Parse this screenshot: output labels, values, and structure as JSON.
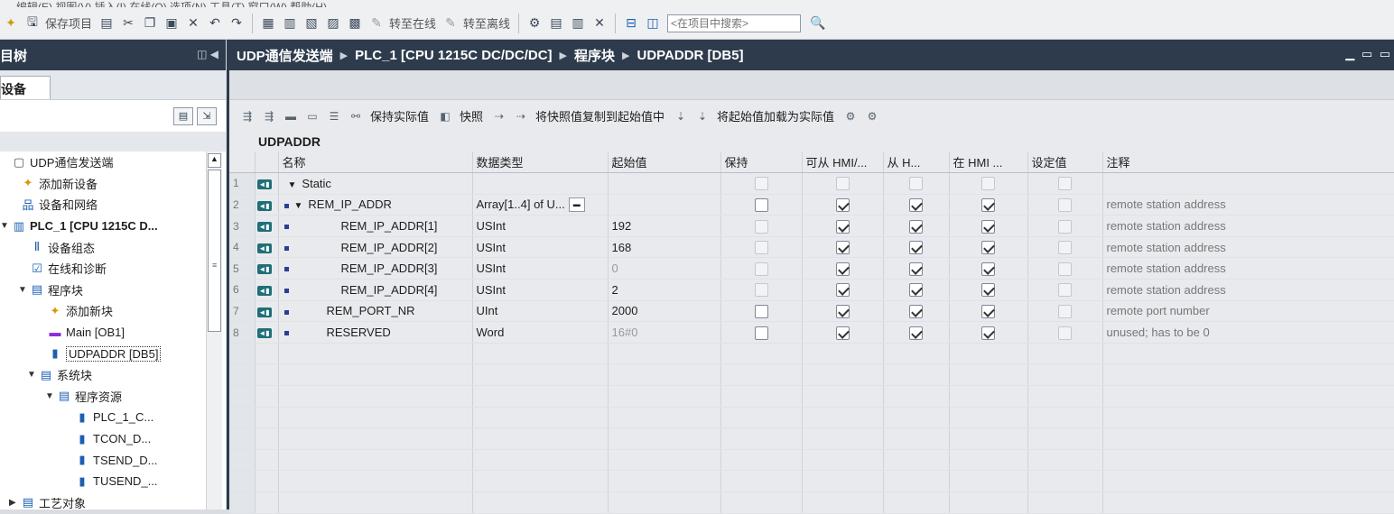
{
  "menubar": {
    "text": "编辑(E)   视图(V)   插入(I)   在线(O)   选项(N)   工具(T)   窗口(W)   帮助(H)"
  },
  "toolbar": {
    "save_project": "保存项目",
    "go_online": "转至在线",
    "go_offline": "转至离线",
    "search_placeholder": "<在项目中搜索>"
  },
  "left_panel": {
    "title": "目树",
    "tab_devices": "设备",
    "tree": [
      {
        "label": "UDP通信发送端",
        "indent": 0,
        "twisty": "",
        "icon": "project-icon"
      },
      {
        "label": "添加新设备",
        "indent": 1,
        "twisty": "",
        "icon": "add-device-icon"
      },
      {
        "label": "设备和网络",
        "indent": 1,
        "twisty": "",
        "icon": "network-icon"
      },
      {
        "label": "PLC_1 [CPU 1215C D...",
        "indent": 0,
        "twisty": "▼",
        "icon": "plc-icon",
        "bold": true
      },
      {
        "label": "设备组态",
        "indent": 2,
        "twisty": "",
        "icon": "device-config-icon"
      },
      {
        "label": "在线和诊断",
        "indent": 2,
        "twisty": "",
        "icon": "diagnostics-icon"
      },
      {
        "label": "程序块",
        "indent": 2,
        "twisty": "▼",
        "icon": "folder-icon"
      },
      {
        "label": "添加新块",
        "indent": 4,
        "twisty": "",
        "icon": "add-block-icon"
      },
      {
        "label": "Main [OB1]",
        "indent": 4,
        "twisty": "",
        "icon": "ob-icon"
      },
      {
        "label": "UDPADDR [DB5]",
        "indent": 4,
        "twisty": "",
        "icon": "db-icon",
        "selected": true
      },
      {
        "label": "系统块",
        "indent": 3,
        "twisty": "▼",
        "icon": "folder-icon"
      },
      {
        "label": "程序资源",
        "indent": 5,
        "twisty": "▼",
        "icon": "folder-icon"
      },
      {
        "label": "PLC_1_C...",
        "indent": 7,
        "twisty": "",
        "icon": "db-icon"
      },
      {
        "label": "TCON_D...",
        "indent": 7,
        "twisty": "",
        "icon": "db-icon"
      },
      {
        "label": "TSEND_D...",
        "indent": 7,
        "twisty": "",
        "icon": "db-icon"
      },
      {
        "label": "TUSEND_...",
        "indent": 7,
        "twisty": "",
        "icon": "db-icon"
      },
      {
        "label": "工艺对象",
        "indent": 1,
        "twisty": "▶",
        "icon": "folder-icon"
      }
    ]
  },
  "editor": {
    "breadcrumb": [
      "UDP通信发送端",
      "PLC_1 [CPU 1215C DC/DC/DC]",
      "程序块",
      "UDPADDR [DB5]"
    ],
    "toolbar": {
      "keep_actual": "保持实际值",
      "snapshot": "快照",
      "copy_snapshot": "将快照值复制到起始值中",
      "load_start": "将起始值加载为实际值"
    },
    "block_name": "UDPADDR",
    "columns": [
      "名称",
      "数据类型",
      "起始值",
      "保持",
      "可从 HMI/...",
      "从 H...",
      "在 HMI ...",
      "设定值",
      "注释"
    ],
    "rows": [
      {
        "num": "1",
        "name": "Static",
        "type": "",
        "start": "",
        "retain": "dis",
        "hmi1": "dis",
        "hmi2": "dis",
        "hmi3": "dis",
        "setpoint": "dis",
        "comment": "",
        "level": 0,
        "caret": true,
        "bullet": false
      },
      {
        "num": "2",
        "name": "REM_IP_ADDR",
        "type": "Array[1..4] of U...",
        "start": "",
        "retain": "off",
        "hmi1": "on",
        "hmi2": "on",
        "hmi3": "on",
        "setpoint": "dis",
        "comment": "remote station address",
        "level": 1,
        "caret": true,
        "bullet": true,
        "dropdown": true
      },
      {
        "num": "3",
        "name": "REM_IP_ADDR[1]",
        "type": "USInt",
        "start": "192",
        "retain": "dis",
        "hmi1": "on",
        "hmi2": "on",
        "hmi3": "on",
        "setpoint": "dis",
        "comment": "remote station address",
        "level": 2,
        "caret": false,
        "bullet": true
      },
      {
        "num": "4",
        "name": "REM_IP_ADDR[2]",
        "type": "USInt",
        "start": "168",
        "retain": "dis",
        "hmi1": "on",
        "hmi2": "on",
        "hmi3": "on",
        "setpoint": "dis",
        "comment": "remote station address",
        "level": 2,
        "caret": false,
        "bullet": true
      },
      {
        "num": "5",
        "name": "REM_IP_ADDR[3]",
        "type": "USInt",
        "start": "0",
        "start_grey": true,
        "retain": "dis",
        "hmi1": "on",
        "hmi2": "on",
        "hmi3": "on",
        "setpoint": "dis",
        "comment": "remote station address",
        "level": 2,
        "caret": false,
        "bullet": true
      },
      {
        "num": "6",
        "name": "REM_IP_ADDR[4]",
        "type": "USInt",
        "start": "2",
        "retain": "dis",
        "hmi1": "on",
        "hmi2": "on",
        "hmi3": "on",
        "setpoint": "dis",
        "comment": "remote station address",
        "level": 2,
        "caret": false,
        "bullet": true
      },
      {
        "num": "7",
        "name": "REM_PORT_NR",
        "type": "UInt",
        "start": "2000",
        "retain": "off",
        "hmi1": "on",
        "hmi2": "on",
        "hmi3": "on",
        "setpoint": "dis",
        "comment": "remote port number",
        "level": 1,
        "caret": false,
        "bullet": true
      },
      {
        "num": "8",
        "name": "RESERVED",
        "type": "Word",
        "start": "16#0",
        "start_grey": true,
        "retain": "off",
        "hmi1": "on",
        "hmi2": "on",
        "hmi3": "on",
        "setpoint": "dis",
        "comment": "unused; has to be 0",
        "level": 1,
        "caret": false,
        "bullet": true
      }
    ]
  }
}
